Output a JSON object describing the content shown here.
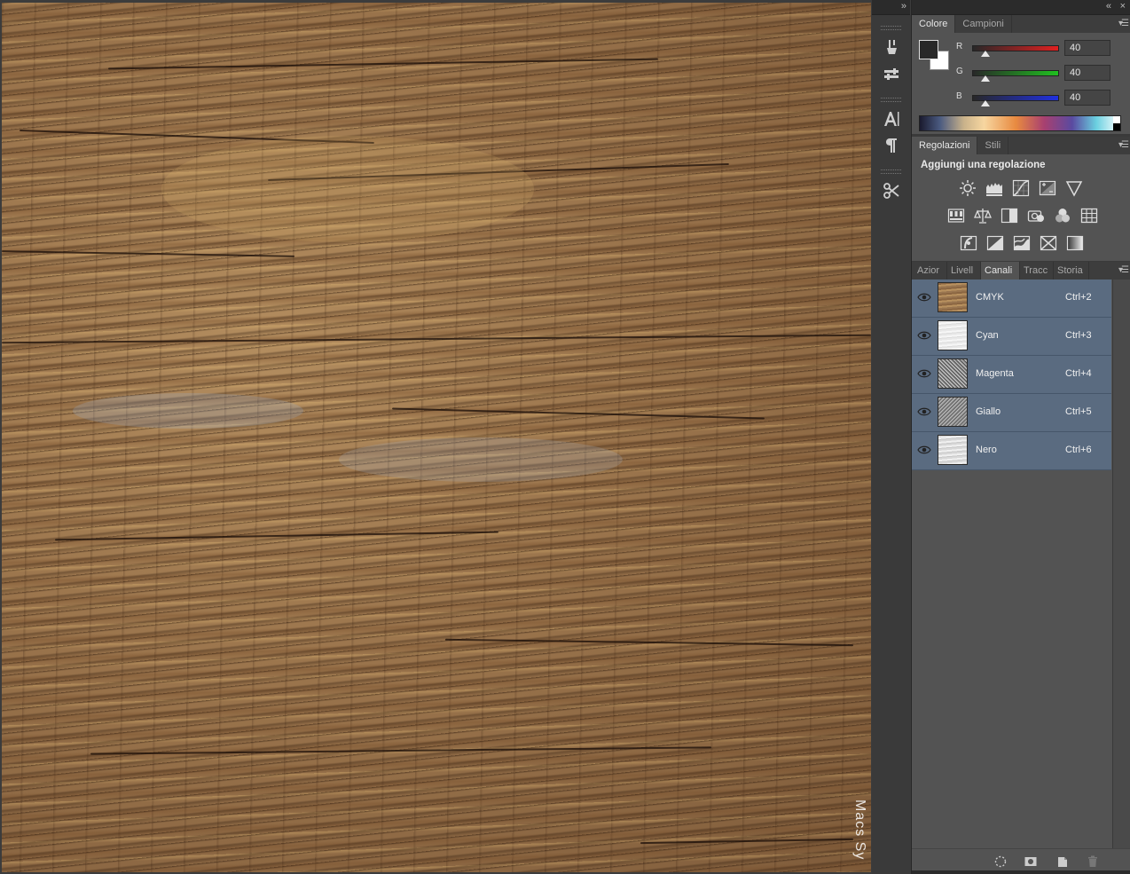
{
  "canvas": {
    "watermark": "Macs Sy"
  },
  "toolstrip": {
    "collapse": "»",
    "tools": [
      {
        "icon": "brush-presets-icon"
      },
      {
        "icon": "tool-presets-icon"
      },
      {
        "icon": "character-icon"
      },
      {
        "icon": "paragraph-icon"
      },
      {
        "icon": "clone-source-icon"
      }
    ]
  },
  "panels": {
    "collapse": "«",
    "close": "×",
    "color": {
      "tabs": [
        "Colore",
        "Campioni"
      ],
      "fg_color": "#282828",
      "bg_color": "#ffffff",
      "channels": [
        {
          "label": "R",
          "value": "40",
          "color": "#e02020"
        },
        {
          "label": "G",
          "value": "40",
          "color": "#20c020"
        },
        {
          "label": "B",
          "value": "40",
          "color": "#2030e0"
        }
      ]
    },
    "adjustments": {
      "tabs": [
        "Regolazioni",
        "Stili"
      ],
      "title": "Aggiungi una regolazione"
    },
    "channels": {
      "tabs": [
        "Azior",
        "Livell",
        "Canali",
        "Tracc",
        "Storia"
      ],
      "active_tab": "Canali",
      "rows": [
        {
          "name": "CMYK",
          "shortcut": "Ctrl+2"
        },
        {
          "name": "Cyan",
          "shortcut": "Ctrl+3"
        },
        {
          "name": "Magenta",
          "shortcut": "Ctrl+4"
        },
        {
          "name": "Giallo",
          "shortcut": "Ctrl+5"
        },
        {
          "name": "Nero",
          "shortcut": "Ctrl+6"
        }
      ]
    }
  }
}
